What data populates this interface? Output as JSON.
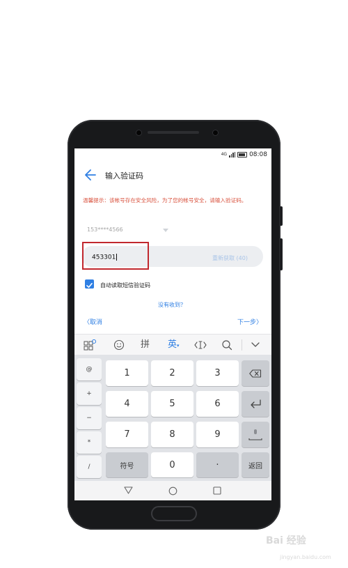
{
  "status_bar": {
    "time": "08:08",
    "network": "4G"
  },
  "header": {
    "title": "输入验证码"
  },
  "warning": {
    "text": "温馨提示：该帐号存在安全风险，为了您的帐号安全，请输入验证码。"
  },
  "phone": {
    "number": "153****4566"
  },
  "code_input": {
    "value": "453301"
  },
  "resend": {
    "label": "重新获取 (40)"
  },
  "auto_read": {
    "label": "自动读取短信验证码",
    "checked": true
  },
  "not_received": {
    "label": "没有收到？"
  },
  "nav": {
    "prev": "取消",
    "next": "下一步"
  },
  "keyboard_toolbar": {
    "pinyin": "拼",
    "english": "英"
  },
  "keyboard": {
    "side_keys": [
      "@",
      "+",
      "−",
      "*",
      "/"
    ],
    "rows": [
      [
        "1",
        "2",
        "3"
      ],
      [
        "4",
        "5",
        "6"
      ],
      [
        "7",
        "8",
        "9"
      ]
    ],
    "symbols_label": "符号",
    "zero": "0",
    "dot": "·",
    "return_label": "返回"
  },
  "watermark": {
    "text": "Bai 经验",
    "sub": "jingyan.baidu.com"
  },
  "colors": {
    "accent": "#2f7fe3",
    "warning": "#d9533f",
    "highlight": "#c1272d"
  }
}
